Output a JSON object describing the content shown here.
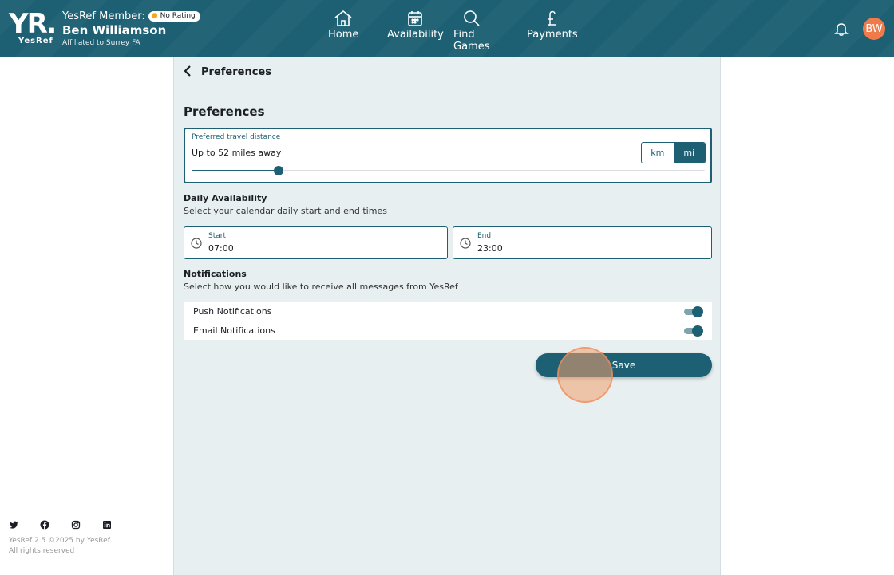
{
  "header": {
    "logo_text": "YR.",
    "logo_sub": "YesRef",
    "member_label": "YesRef Member:",
    "rating_badge": "No Rating",
    "member_name": "Ben Williamson",
    "affiliation": "Affiliated to Surrey FA",
    "nav": [
      {
        "label": "Home",
        "icon": "home-icon"
      },
      {
        "label": "Availability",
        "icon": "calendar-icon"
      },
      {
        "label": "Find Games",
        "icon": "search-icon"
      },
      {
        "label": "Payments",
        "icon": "pound-icon"
      }
    ],
    "avatar_initials": "BW",
    "colors": {
      "primary": "#1d5f73",
      "avatar": "#f07b4a"
    }
  },
  "page": {
    "back_title": "Preferences",
    "section_title": "Preferences",
    "travel": {
      "label": "Preferred travel distance",
      "value_text": "Up to 52 miles away",
      "units": [
        "km",
        "mi"
      ],
      "selected_unit": "mi",
      "slider_fraction": 0.17
    },
    "daily": {
      "heading": "Daily Availability",
      "description": "Select your calendar daily start and end times",
      "start_label": "Start",
      "start_value": "07:00",
      "end_label": "End",
      "end_value": "23:00"
    },
    "notifications": {
      "heading": "Notifications",
      "description": "Select how you would like to receive all messages from YesRef",
      "items": [
        {
          "label": "Push Notifications",
          "enabled": true
        },
        {
          "label": "Email Notifications",
          "enabled": true
        }
      ]
    },
    "save_label": "Save"
  },
  "footer": {
    "social": [
      "twitter-icon",
      "facebook-icon",
      "instagram-icon",
      "linkedin-icon"
    ],
    "version": "YesRef 2.5 ©2025 by YesRef.",
    "rights": "All rights reserved"
  }
}
